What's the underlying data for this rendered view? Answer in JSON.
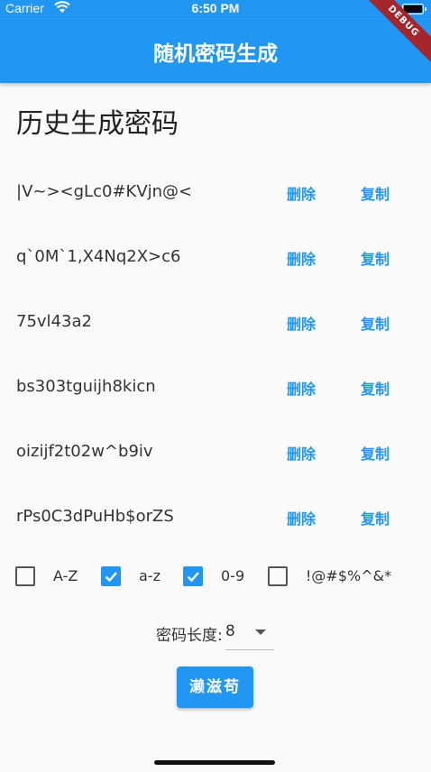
{
  "status_bar": {
    "carrier": "Carrier",
    "time": "6:50 PM",
    "wifi_icon": "wifi-icon",
    "battery_icon": "battery-icon"
  },
  "debug_banner": "DEBUG",
  "app_bar": {
    "title": "随机密码生成",
    "color": "#2196f3"
  },
  "history": {
    "title": "历史生成密码",
    "delete_label": "删除",
    "copy_label": "复制",
    "items": [
      "|V~><gLc0#KVjn@<",
      "q`0M`1,X4Nq2X>c6",
      "75vl43a2",
      "bs303tguijh8kicn",
      "oizijf2t02w^b9iv",
      "rPs0C3dPuHb$orZS"
    ]
  },
  "options": [
    {
      "label": "A-Z",
      "checked": false
    },
    {
      "label": "a-z",
      "checked": true
    },
    {
      "label": "0-9",
      "checked": true
    },
    {
      "label": "!@#$%^&*",
      "checked": false
    }
  ],
  "length": {
    "label": "密码长度:",
    "value": "8"
  },
  "generate_button": {
    "label": "濑滋苟"
  },
  "accent_color": "#2196f3"
}
